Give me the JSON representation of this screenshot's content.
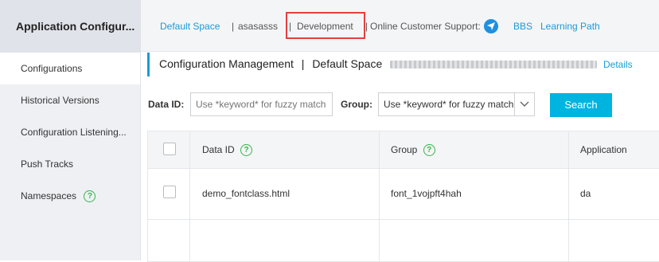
{
  "sidebar": {
    "title": "Application Configur...",
    "items": [
      {
        "label": "Configurations",
        "active": true
      },
      {
        "label": "Historical Versions",
        "active": false
      },
      {
        "label": "Configuration Listening...",
        "active": false
      },
      {
        "label": "Push Tracks",
        "active": false
      },
      {
        "label": "Namespaces",
        "active": false,
        "help": true
      }
    ]
  },
  "topbar": {
    "default_space": "Default Space",
    "sep1": "|",
    "user": "asasasss",
    "sep2": "|",
    "environment": "Development",
    "sep3": "|",
    "support_label": "Online Customer Support:",
    "bbs": "BBS",
    "learning_path": "Learning Path"
  },
  "header": {
    "title": "Configuration Management",
    "sep": "|",
    "space": "Default Space",
    "details": "Details"
  },
  "filters": {
    "data_id_label": "Data ID:",
    "data_id_placeholder": "Use *keyword* for fuzzy match",
    "group_label": "Group:",
    "group_value": "Use *keyword* for fuzzy match",
    "search_button": "Search"
  },
  "table": {
    "columns": [
      "Data ID",
      "Group",
      "Application"
    ],
    "rows": [
      {
        "data_id": "demo_fontclass.html",
        "group": "font_1vojpft4hah",
        "application": "da"
      }
    ]
  },
  "colors": {
    "accent": "#1a9bd6",
    "button": "#00b4e0",
    "highlight": "#e53f3f",
    "help": "#34b648"
  }
}
